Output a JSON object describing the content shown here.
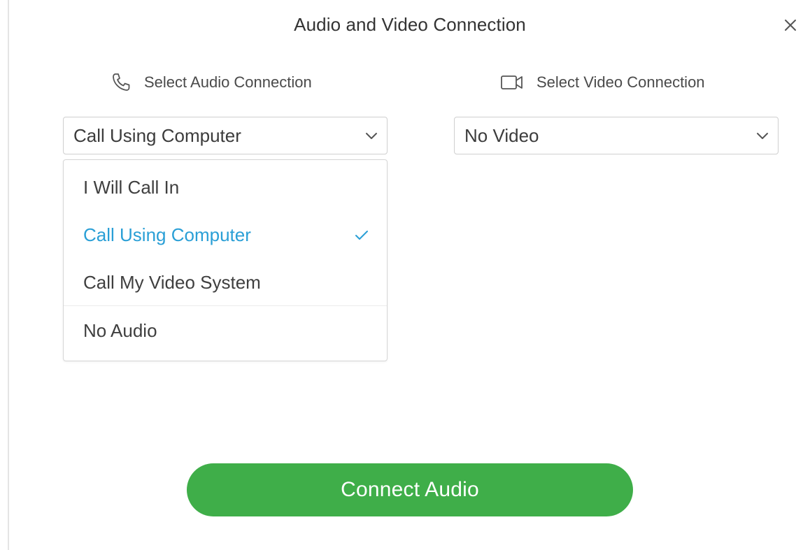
{
  "dialog": {
    "title": "Audio and Video Connection",
    "close_icon": "close-icon"
  },
  "audio": {
    "label": "Select Audio Connection",
    "icon": "phone-icon",
    "selected_value": "Call Using Computer",
    "options": [
      {
        "label": "I Will Call In",
        "selected": false
      },
      {
        "label": "Call Using Computer",
        "selected": true
      },
      {
        "label": "Call My Video System",
        "selected": false
      },
      {
        "label": "No Audio",
        "selected": false
      }
    ]
  },
  "video": {
    "label": "Select Video Connection",
    "icon": "video-camera-icon",
    "selected_value": "No Video"
  },
  "actions": {
    "connect_label": "Connect Audio"
  },
  "colors": {
    "accent_blue": "#2a9fd6",
    "button_green": "#3fae49"
  }
}
